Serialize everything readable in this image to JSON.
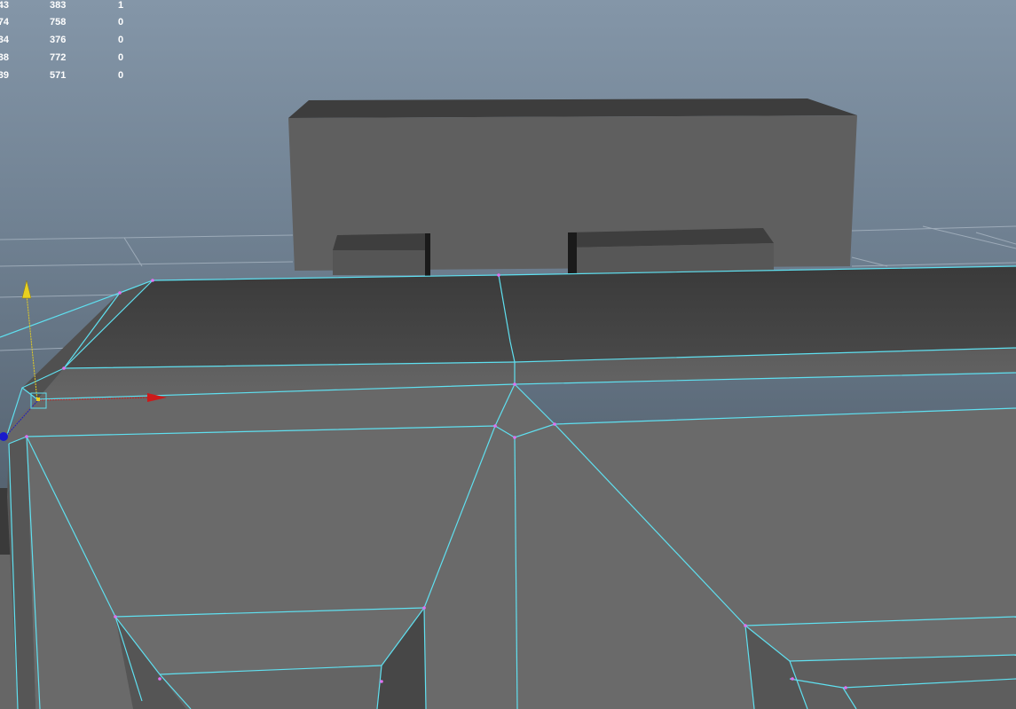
{
  "viewport": {
    "name": "3d-modeling-viewport",
    "colors": {
      "background_top": "#8293a6",
      "background_bottom": "#52606d",
      "grid_line": "#a9b6c2",
      "mesh_top_face": "#464646",
      "mesh_front_face": "#6b6b6b",
      "background_box": "#606060",
      "wireframe_edge": "#5fe0f0",
      "vertex_marker": "#e070f0",
      "manipulator_x": "#cc1a1a",
      "manipulator_y": "#e8d020",
      "manipulator_z": "#2020c0"
    }
  },
  "hud": {
    "rows": [
      {
        "col1": "43",
        "col2": "383",
        "col3": "1"
      },
      {
        "col1": "74",
        "col2": "758",
        "col3": "0"
      },
      {
        "col1": "34",
        "col2": "376",
        "col3": "0"
      },
      {
        "col1": "38",
        "col2": "772",
        "col3": "0"
      },
      {
        "col1": "39",
        "col2": "571",
        "col3": "0"
      }
    ]
  },
  "manipulator": {
    "type": "move-tool",
    "selected_vertex": "corner-vertex"
  }
}
